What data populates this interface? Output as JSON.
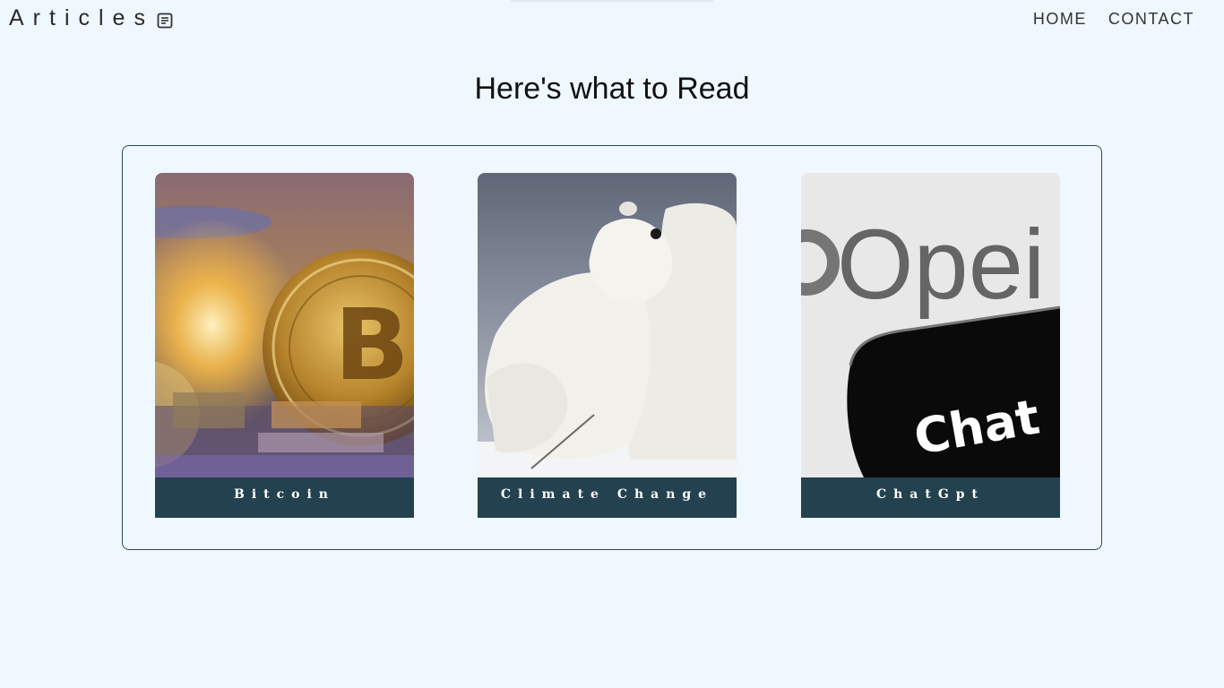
{
  "header": {
    "brand": "Articles",
    "brand_icon": "article-icon",
    "nav": [
      {
        "label": "HOME"
      },
      {
        "label": "CONTACT"
      }
    ]
  },
  "main": {
    "title": "Here's what to Read",
    "cards": [
      {
        "caption": "Bitcoin",
        "image": "bitcoin-coin-image"
      },
      {
        "caption": "Climate Change",
        "image": "polar-bears-image"
      },
      {
        "caption": "ChatGpt",
        "image": "chatgpt-phone-image"
      }
    ]
  },
  "colors": {
    "background": "#eff7ff",
    "caption_bg": "#23414f",
    "panel_border": "#2d4a58"
  }
}
